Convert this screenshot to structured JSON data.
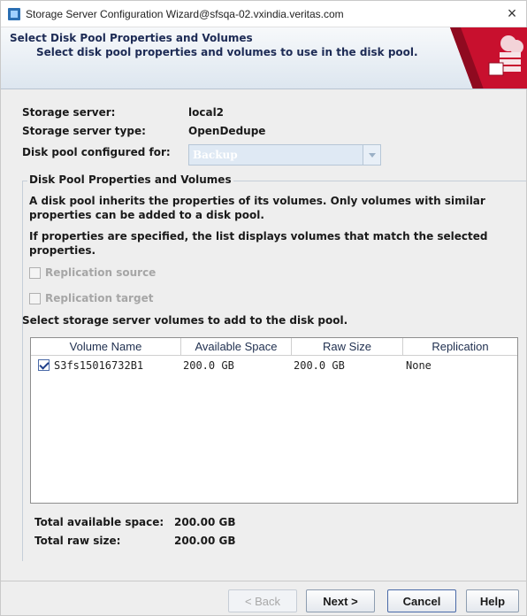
{
  "window": {
    "title": "Storage Server Configuration Wizard@sfsqa-02.vxindia.veritas.com",
    "close_glyph": "×"
  },
  "banner": {
    "title": "Select Disk Pool Properties and Volumes",
    "subtitle": "Select disk pool properties and volumes to use in the disk pool."
  },
  "info": {
    "storage_server_label": "Storage server:",
    "storage_server_value": "local2",
    "storage_server_type_label": "Storage server type:",
    "storage_server_type_value": "OpenDedupe",
    "configured_for_label": "Disk pool configured for:",
    "configured_for_value": "Backup"
  },
  "group": {
    "title": "Disk Pool Properties and Volumes",
    "para1": "A disk pool inherits the properties of its volumes. Only volumes with similar properties can be added to a disk pool.",
    "para2": "If properties are specified, the list displays volumes that match the selected properties.",
    "replication_source_label": "Replication source",
    "replication_target_label": "Replication target",
    "select_label": "Select storage server volumes to add to the disk pool."
  },
  "table": {
    "headers": [
      "Volume Name",
      "Available Space",
      "Raw Size",
      "Replication"
    ],
    "rows": [
      {
        "checked": true,
        "name": "S3fs15016732B1",
        "available": "200.0 GB",
        "raw": "200.0 GB",
        "replication": "None"
      }
    ]
  },
  "totals": {
    "available_label": "Total available space:",
    "available_value": "200.00 GB",
    "raw_label": "Total raw size:",
    "raw_value": "200.00 GB"
  },
  "buttons": {
    "back": "< Back",
    "next": "Next >",
    "cancel": "Cancel",
    "help": "Help"
  },
  "colors": {
    "banner_accent": "#c8102e",
    "title_text": "#1d2b55"
  }
}
